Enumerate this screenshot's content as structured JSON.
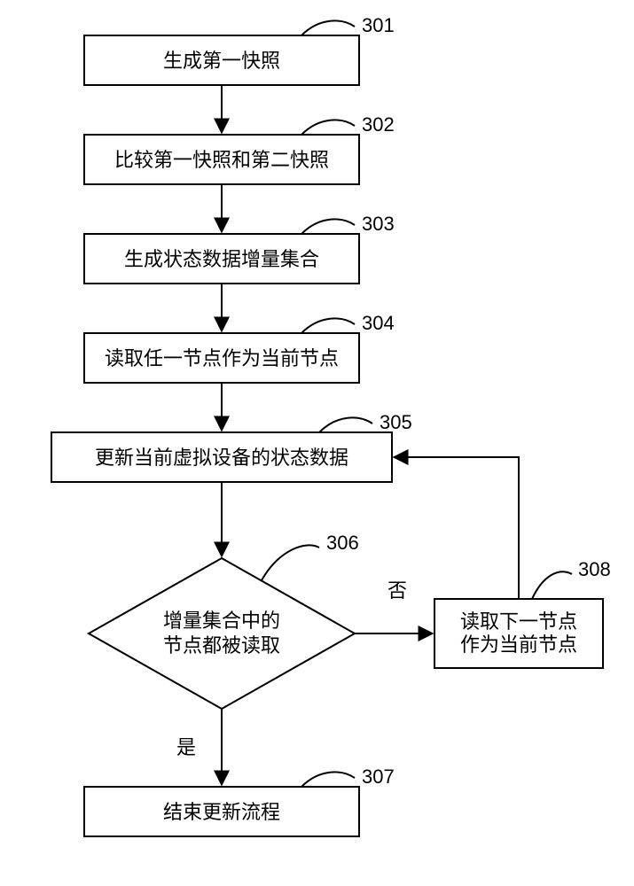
{
  "nodes": {
    "n301": {
      "label": "生成第一快照",
      "tag": "301"
    },
    "n302": {
      "label": "比较第一快照和第二快照",
      "tag": "302"
    },
    "n303": {
      "label": "生成状态数据增量集合",
      "tag": "303"
    },
    "n304": {
      "label": "读取任一节点作为当前节点",
      "tag": "304"
    },
    "n305": {
      "label": "更新当前虚拟设备的状态数据",
      "tag": "305"
    },
    "n306": {
      "line1": "增量集合中的",
      "line2": "节点都被读取",
      "tag": "306"
    },
    "n307": {
      "label": "结束更新流程",
      "tag": "307"
    },
    "n308": {
      "line1": "读取下一节点",
      "line2": "作为当前节点",
      "tag": "308"
    }
  },
  "edges": {
    "yes": "是",
    "no": "否"
  }
}
